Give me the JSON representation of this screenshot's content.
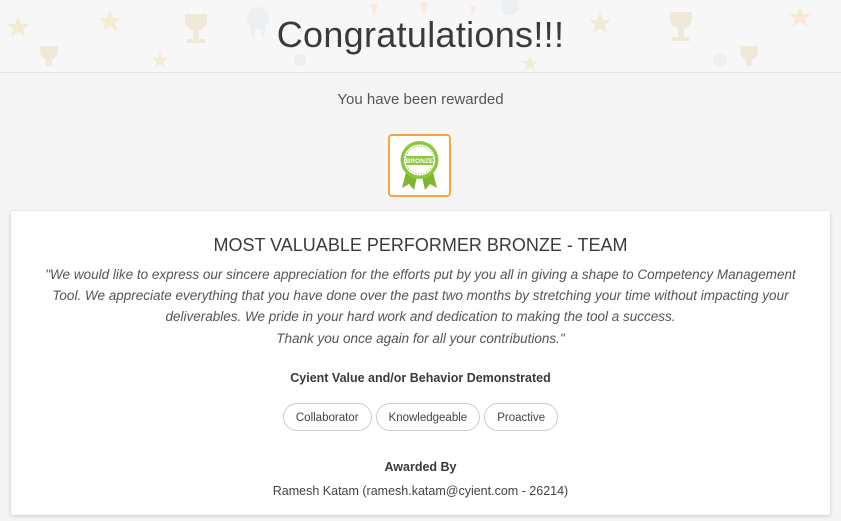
{
  "banner": {
    "title": "Congratulations!!!"
  },
  "reward": {
    "subtitle": "You have been rewarded",
    "badge_text": "BRONZE",
    "badge_icon": "bronze-badge-icon"
  },
  "award": {
    "title": "MOST VALUABLE PERFORMER BRONZE - TEAM",
    "message_lines": [
      "\"We would like to express our sincere appreciation for the efforts put by you all in giving a shape to Competency Management",
      "Tool. We appreciate everything that you have done over the past two months by stretching your time without impacting your",
      "deliverables. We pride in your hard work and dedication to making the tool a success.",
      "Thank you once again for all your contributions.\""
    ],
    "values_heading": "Cyient Value and/or Behavior Demonstrated",
    "values": [
      "Collaborator",
      "Knowledgeable",
      "Proactive"
    ],
    "awarded_by_heading": "Awarded By",
    "awarded_by": "Ramesh Katam (ramesh.katam@cyient.com - 26214)"
  },
  "colors": {
    "badge_border": "#f4a640",
    "badge_green": "#8dc63f"
  }
}
